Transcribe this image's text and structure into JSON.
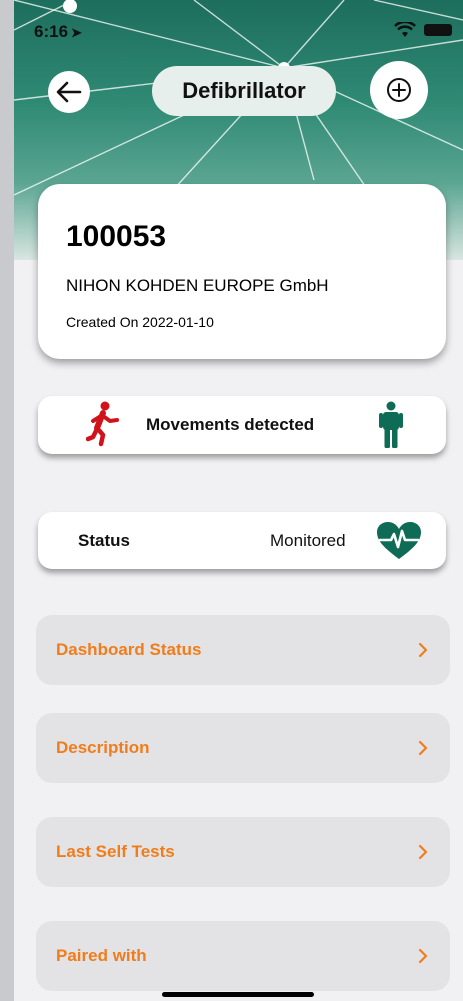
{
  "status_bar": {
    "time": "6:16",
    "location_glyph": "➤"
  },
  "header": {
    "title": "Defibrillator"
  },
  "device": {
    "id": "100053",
    "manufacturer": "NIHON KOHDEN EUROPE GmbH",
    "created": "Created On 2022-01-10"
  },
  "movement": {
    "text": "Movements detected",
    "color_active": "#d0121b",
    "color_idle": "#0e6b55"
  },
  "status": {
    "label": "Status",
    "value": "Monitored",
    "icon_color": "#0e6b55"
  },
  "menu": [
    {
      "label": "Dashboard Status"
    },
    {
      "label": "Description"
    },
    {
      "label": "Last Self Tests"
    },
    {
      "label": "Paired with"
    }
  ],
  "colors": {
    "accent": "#f07d1c",
    "brand": "#1d6e5c"
  }
}
